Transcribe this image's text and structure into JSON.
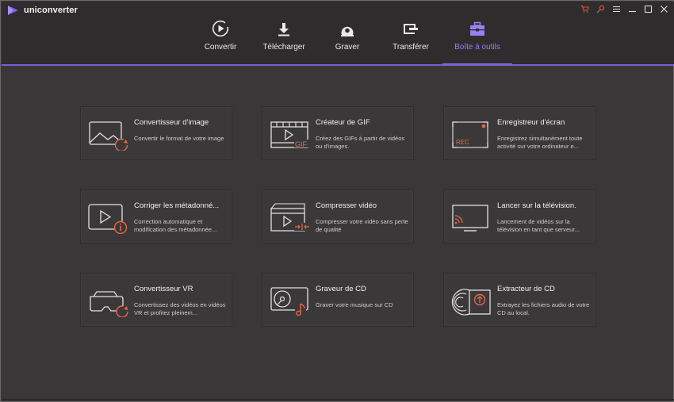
{
  "app": {
    "name": "uniconverter",
    "accent_color": "#8e72ea",
    "icon_accent_color": "#e56a45"
  },
  "window_controls": [
    {
      "name": "cart-icon"
    },
    {
      "name": "key-icon"
    },
    {
      "name": "menu-icon"
    },
    {
      "name": "minimize-icon"
    },
    {
      "name": "maximize-icon"
    },
    {
      "name": "close-icon"
    }
  ],
  "nav": {
    "items": [
      {
        "label": "Convertir",
        "icon": "convert-icon"
      },
      {
        "label": "Télécharger",
        "icon": "download-icon"
      },
      {
        "label": "Graver",
        "icon": "burn-icon"
      },
      {
        "label": "Transférer",
        "icon": "transfer-icon"
      },
      {
        "label": "Boîte à outils",
        "icon": "toolbox-icon",
        "active": true
      }
    ]
  },
  "tools": [
    {
      "title": "Convertisseur d'image",
      "desc": "Convertir le format de votre image",
      "icon": "image-convert-icon"
    },
    {
      "title": "Créateur de GIF",
      "desc": "Créez des GIFs à partir de vidéos ou d'images.",
      "icon": "gif-maker-icon",
      "badge": "GIF"
    },
    {
      "title": "Enregistreur d'écran",
      "desc": "Enregistrez simultanément toute activité sur votre ordinateur e...",
      "icon": "screen-recorder-icon",
      "badge": "REC"
    },
    {
      "title": "Corriger les métadonné...",
      "desc": "Correction automatique et modification des métadonnée...",
      "icon": "metadata-icon"
    },
    {
      "title": "Compresser vidéo",
      "desc": "Compresser votre vidéo sans perte de qualité",
      "icon": "compress-icon"
    },
    {
      "title": "Lancer sur la télévision.",
      "desc": "Lancement de vidéos sur la télévision en tant que serveur...",
      "icon": "cast-tv-icon"
    },
    {
      "title": "Convertisseur VR",
      "desc": "Convertissez des vidéos en vidéos VR et profitez pleinem...",
      "icon": "vr-convert-icon"
    },
    {
      "title": "Graveur de CD",
      "desc": "Graver votre musique sur CD",
      "icon": "cd-burner-icon"
    },
    {
      "title": "Extracteur de CD",
      "desc": "Extrayez les fichiers audio de votre CD au local.",
      "icon": "cd-ripper-icon"
    }
  ]
}
